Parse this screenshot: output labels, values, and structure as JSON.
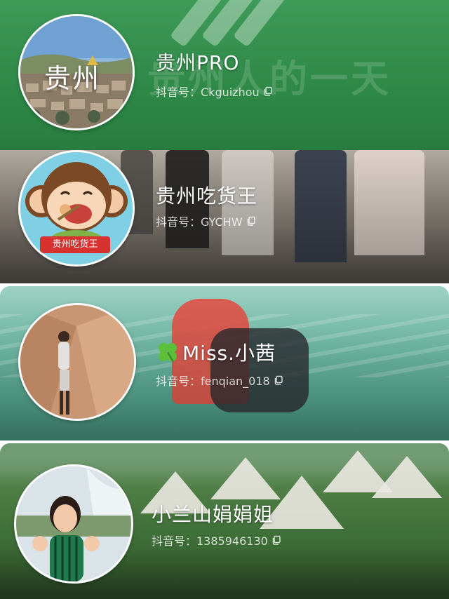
{
  "colors": {
    "brand_green": "#2f8a48",
    "text_white": "#ffffff"
  },
  "accounts": [
    {
      "avatar_label": "贵州",
      "name": "贵州PRO",
      "id_line": "抖音号：Ckguizhou",
      "watermark": "贵州人的一天",
      "icon": "copy-icon"
    },
    {
      "avatar_label": "贵州吃货王",
      "name": "贵州吃货王",
      "id_line": "抖音号：GYCHW",
      "icon": "copy-icon"
    },
    {
      "name": "Miss.小茜",
      "id_line": "抖音号：fenqian_018",
      "name_icon": "clover-icon",
      "icon": "copy-icon"
    },
    {
      "name": "小兰山娟娟姐",
      "id_line": "抖音号：1385946130",
      "icon": "copy-icon"
    }
  ]
}
